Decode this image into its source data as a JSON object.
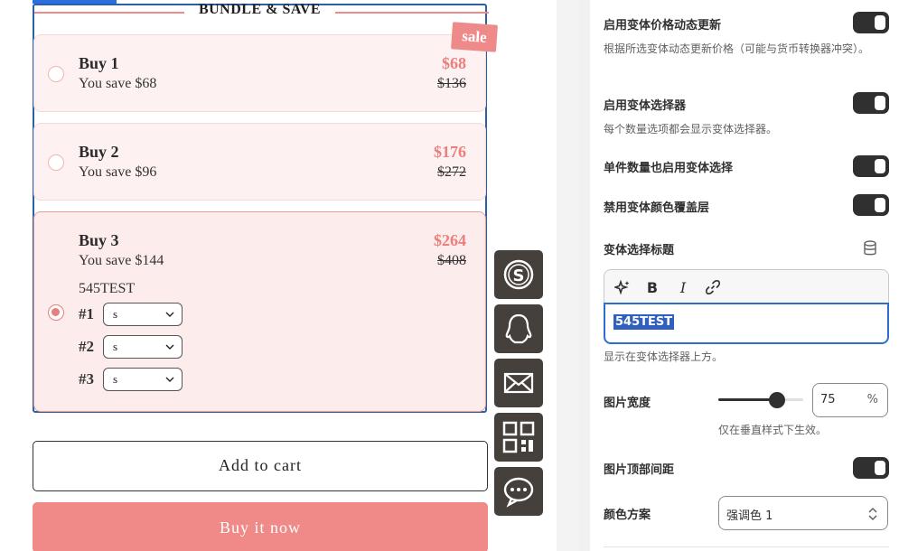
{
  "preview": {
    "bundle_title": "BUNDLE & SAVE",
    "sale_badge": "sale",
    "options": [
      {
        "title": "Buy 1",
        "save": "You save $68",
        "price": "$68",
        "compare": "$136",
        "selected": false
      },
      {
        "title": "Buy 2",
        "save": "You save $96",
        "price": "$176",
        "compare": "$272",
        "selected": false
      },
      {
        "title": "Buy 3",
        "save": "You save $144",
        "price": "$264",
        "compare": "$408",
        "selected": true,
        "variant_title": "545TEST",
        "variants": [
          {
            "num": "#1",
            "value": "s"
          },
          {
            "num": "#2",
            "value": "s"
          },
          {
            "num": "#3",
            "value": "s"
          }
        ]
      }
    ],
    "add_to_cart": "Add to cart",
    "buy_now": "Buy it now",
    "side_icons": [
      "skype-icon",
      "qq-penguin-icon",
      "mail-icon",
      "qr-code-icon",
      "chat-bubble-icon"
    ],
    "colors": {
      "accent": "#ef8a88",
      "border": "#2b5fa8",
      "icon_bg": "#46403c"
    }
  },
  "settings": {
    "dynamic_price": {
      "label": "启用变体价格动态更新",
      "help": "根据所选变体动态更新价格（可能与货币转换器冲突）。",
      "on": true
    },
    "variant_picker": {
      "label": "启用变体选择器",
      "help": "每个数量选项都会显示变体选择器。",
      "on": true
    },
    "single_qty_picker": {
      "label": "单件数量也启用变体选择",
      "on": true
    },
    "disable_color_overlay": {
      "label": "禁用变体颜色覆盖层",
      "on": true
    },
    "picker_title": {
      "label": "变体选择标题",
      "value": "545TEST",
      "help": "显示在变体选择器上方。"
    },
    "image_width": {
      "label": "图片宽度",
      "value": "75",
      "unit": "%",
      "fraction": 0.75,
      "help": "仅在垂直样式下生效。"
    },
    "image_top_spacing": {
      "label": "图片顶部间距",
      "on": true
    },
    "color_scheme": {
      "label": "颜色方案",
      "value": "强调色 1"
    }
  }
}
